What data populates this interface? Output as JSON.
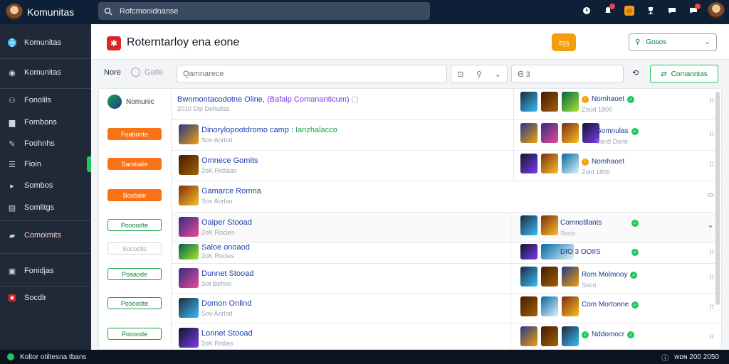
{
  "topbar": {
    "app_title": "Komunitas",
    "search_value": "Rofcmonidnanse"
  },
  "sidebar": {
    "items": [
      {
        "label": "Komunitas",
        "icon": "globe-icon"
      },
      {
        "label": "Komunitas",
        "icon": "circle-icon"
      },
      {
        "label": "Fonolils",
        "icon": "people-icon"
      },
      {
        "label": "Fombons",
        "icon": "folder-icon"
      },
      {
        "label": "Foohnhs",
        "icon": "pen-icon"
      },
      {
        "label": "Fioin",
        "icon": "list-icon"
      },
      {
        "label": "Sombos",
        "icon": "chevron-right-icon"
      },
      {
        "label": "Somlitgs",
        "icon": "doc-icon"
      },
      {
        "label": "Comoimits",
        "icon": "chat-icon"
      },
      {
        "label": "Fonidjas",
        "icon": "image-icon"
      },
      {
        "label": "Socdlr",
        "icon": "flag-icon"
      }
    ]
  },
  "header": {
    "title": "Roterntarloy ena eone",
    "action_label": "ꝺꝫꝫ",
    "select_label": "Gosos"
  },
  "filters": {
    "label": "Nore",
    "toggle_label": "Gatle",
    "search_placeholder": "Qamnarece",
    "date_placeholder": "Ꞡ 3",
    "green_button": "Comanntas"
  },
  "tags": [
    {
      "label": "Nomunic",
      "style": "plain"
    },
    {
      "label": "Foabonte",
      "style": "orange"
    },
    {
      "label": "Sambalis",
      "style": "orange"
    },
    {
      "label": "Bocbale",
      "style": "orange"
    },
    {
      "label": "Poooodte",
      "style": "outline"
    },
    {
      "label": "Socootic",
      "style": "faded"
    },
    {
      "label": "Poaaode",
      "style": "outline"
    },
    {
      "label": "Poooodte",
      "style": "outline"
    },
    {
      "label": "Poooode",
      "style": "outline"
    }
  ],
  "rows": [
    {
      "title": "Bwnmontacodotne Oline,",
      "title_extra": "(Bafaip Comananticum)",
      "subtitle": "2010 Dlp Dohullas",
      "user": "Nomhaoet",
      "user_sub": "Zoud 1800",
      "status": "check"
    },
    {
      "title": "Dinorylopootdromo camp :",
      "title_extra": "Ianzhalacco",
      "subtitle": "Sov Aorlod",
      "user": "Gomnulas",
      "user_sub": "Sand Dorle",
      "status": "check"
    },
    {
      "title": "Omnece Gomits",
      "subtitle": "2oK Rrdlaas",
      "user": "Nomhaoet",
      "user_sub": "Zold 1800",
      "status": "warn"
    },
    {
      "title": "Gamarce Romna",
      "subtitle": "Sov Aorlou",
      "user": "",
      "user_sub": "",
      "status": ""
    },
    {
      "title": "Oaiper Stooad",
      "subtitle": "2oK Rocles",
      "user": "Comnotllants",
      "user_sub": "Soco",
      "status": "check"
    },
    {
      "title": "Saloe onoaod",
      "subtitle": "2oK Rocles",
      "user": "DIO 3 OOIIS",
      "user_sub": "",
      "status": "check"
    },
    {
      "title": "Dunnet Stooad",
      "subtitle": "Sot Bohno",
      "user": "Rom Molmnoy",
      "user_sub": "Soco",
      "status": "check"
    },
    {
      "title": "Domon Onlind",
      "subtitle": "Sov Aorlod",
      "user": "Com Mortonne",
      "user_sub": "",
      "status": "check"
    },
    {
      "title": "Lonnet Stooad",
      "subtitle": "2oK Rrdlas",
      "user": "Nddomocr",
      "user_sub": "",
      "status": "check"
    }
  ],
  "statusbar": {
    "left": "Koltor otiltesna tbans",
    "right": "ᴡᴅɴ 200 2050"
  }
}
